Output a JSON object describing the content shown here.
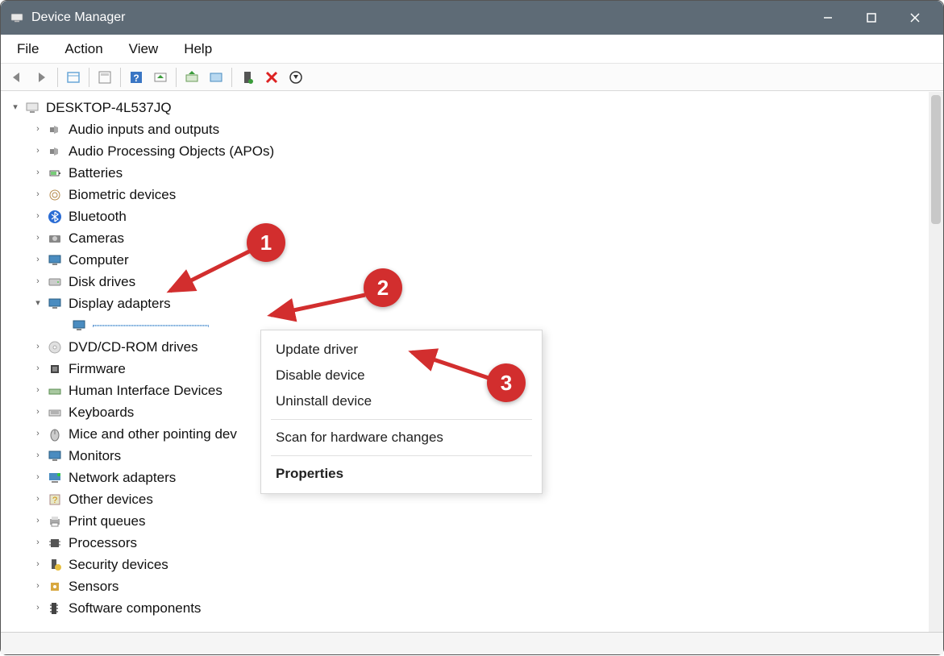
{
  "window": {
    "title": "Device Manager"
  },
  "menus": {
    "file": "File",
    "action": "Action",
    "view": "View",
    "help": "Help"
  },
  "tree": {
    "root": "DESKTOP-4L537JQ",
    "items": [
      {
        "label": "Audio inputs and outputs",
        "icon": "speaker"
      },
      {
        "label": "Audio Processing Objects (APOs)",
        "icon": "speaker"
      },
      {
        "label": "Batteries",
        "icon": "battery"
      },
      {
        "label": "Biometric devices",
        "icon": "fingerprint"
      },
      {
        "label": "Bluetooth",
        "icon": "bluetooth"
      },
      {
        "label": "Cameras",
        "icon": "camera"
      },
      {
        "label": "Computer",
        "icon": "monitor"
      },
      {
        "label": "Disk drives",
        "icon": "disk"
      },
      {
        "label": "Display adapters",
        "icon": "monitor",
        "expanded": true,
        "children": [
          {
            "label": "",
            "icon": "monitor",
            "selected": true
          }
        ]
      },
      {
        "label": "DVD/CD-ROM drives",
        "icon": "disc"
      },
      {
        "label": "Firmware",
        "icon": "chip"
      },
      {
        "label": "Human Interface Devices",
        "icon": "hid"
      },
      {
        "label": "Keyboards",
        "icon": "keyboard"
      },
      {
        "label": "Mice and other pointing devices",
        "icon": "mouse",
        "truncated": "Mice and other pointing dev"
      },
      {
        "label": "Monitors",
        "icon": "monitor"
      },
      {
        "label": "Network adapters",
        "icon": "network"
      },
      {
        "label": "Other devices",
        "icon": "unknown"
      },
      {
        "label": "Print queues",
        "icon": "printer"
      },
      {
        "label": "Processors",
        "icon": "cpu"
      },
      {
        "label": "Security devices",
        "icon": "lock"
      },
      {
        "label": "Sensors",
        "icon": "sensor"
      },
      {
        "label": "Software components",
        "icon": "component"
      }
    ]
  },
  "context_menu": {
    "update": "Update driver",
    "disable": "Disable device",
    "uninstall": "Uninstall device",
    "scan": "Scan for hardware changes",
    "properties": "Properties"
  },
  "annotations": {
    "b1": "1",
    "b2": "2",
    "b3": "3"
  }
}
